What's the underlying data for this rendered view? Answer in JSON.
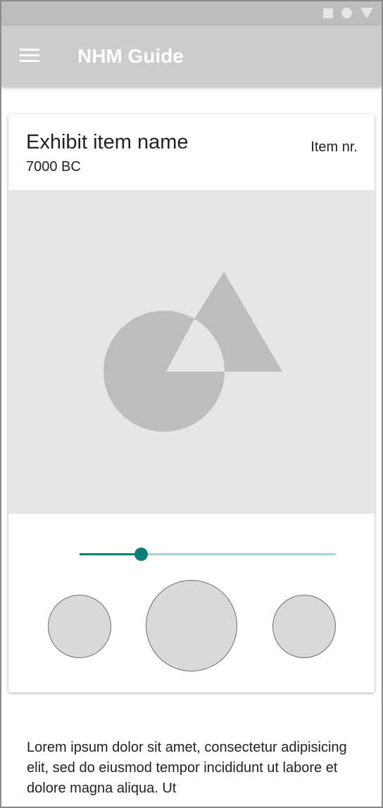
{
  "status_bar": {
    "icons": [
      "square-icon",
      "circle-icon",
      "triangle-icon"
    ]
  },
  "app_bar": {
    "menu_icon": "hamburger-menu-icon",
    "title": "NHM Guide"
  },
  "exhibit_card": {
    "title": "Exhibit item name",
    "subtitle": "7000 BC",
    "item_number_label": "Item nr.",
    "image_placeholder_icon": "image-placeholder-icon",
    "playback": {
      "progress_fraction": 0.24,
      "buttons": [
        "previous-button",
        "play-button",
        "next-button"
      ]
    }
  },
  "description": {
    "text": "Lorem ipsum dolor sit amet, consectetur adipisicing elit, sed do eiusmod tempor incididunt ut labore et dolore magna aliqua. Ut"
  },
  "colors": {
    "accent": "#0a7d76",
    "accent_light": "#a8d5d3",
    "app_bar": "#cccccc",
    "status_bar": "#bdbdbd",
    "placeholder": "#e6e6e6",
    "placeholder_shape": "#bdbdbd"
  }
}
